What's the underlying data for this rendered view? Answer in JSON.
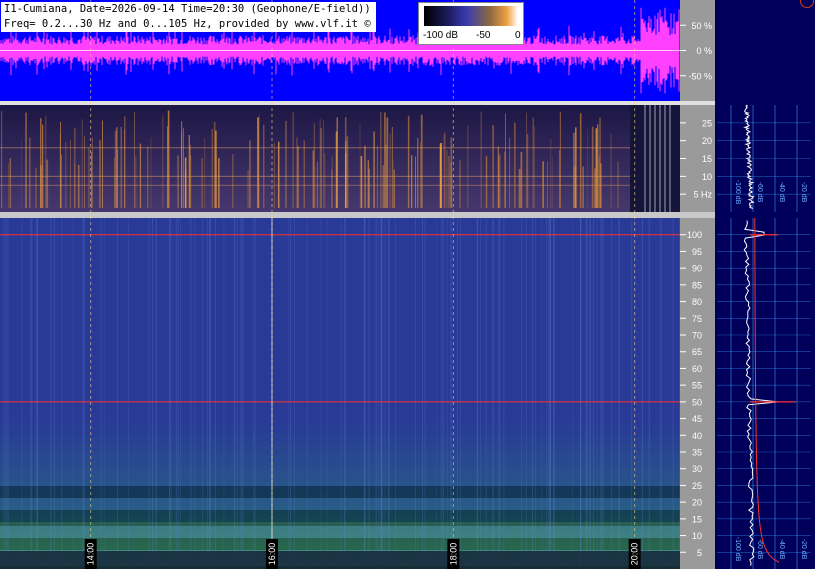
{
  "header": {
    "line1": "I1-Cumiana, Date=2026-09-14 Time=20:30 (Geophone/E-field))",
    "line2": "Freq= 0.2...30 Hz and 0...105 Hz, provided by www.vlf.it ©"
  },
  "colorbar": {
    "label_min": "-100 dB",
    "label_mid": "-50",
    "label_max": "0"
  },
  "colors": {
    "waveform_bg": "#0000ff",
    "waveform": "#ff40ff",
    "spectrum_line": "#ff3030",
    "profile": "#ffffff",
    "grid": "#3aa0ff",
    "right_bg": "#00005a"
  },
  "chart_data": [
    {
      "type": "line",
      "name": "waveform",
      "ylabel_ticks": [
        "50 %",
        "0 %",
        "-50 %"
      ],
      "ylim": [
        -100,
        100
      ],
      "xlim": [
        13.0,
        20.5
      ],
      "x_ticks": [
        "14:00",
        "16:00",
        "18:00",
        "20:00"
      ]
    },
    {
      "type": "heatmap",
      "name": "spectrogram-low",
      "ylabel_ticks": [
        "25",
        "20",
        "15",
        "10",
        "5 Hz"
      ],
      "ylim": [
        0,
        30
      ],
      "xlim": [
        13.0,
        20.5
      ]
    },
    {
      "type": "heatmap",
      "name": "spectrogram-high",
      "ylabel_ticks": [
        "100",
        "95",
        "90",
        "85",
        "80",
        "75",
        "70",
        "65",
        "60",
        "55",
        "50",
        "45",
        "40",
        "35",
        "30",
        "25",
        "20",
        "15",
        "10",
        "5"
      ],
      "ylim": [
        0,
        105
      ],
      "xlim": [
        13.0,
        20.5
      ],
      "x_ticks": [
        "14:00",
        "16:00",
        "18:00",
        "20:00"
      ],
      "lines_hz": [
        100,
        50
      ]
    },
    {
      "type": "line",
      "name": "profile-low",
      "x_ticks": [
        "-100 dB",
        "-60 dB",
        "-40 dB",
        "-20 dB"
      ],
      "ylim": [
        0,
        30
      ]
    },
    {
      "type": "line",
      "name": "profile-high",
      "x_ticks": [
        "-100 dB",
        "-60 dB",
        "-40 dB",
        "-20 dB"
      ],
      "ylim": [
        0,
        105
      ]
    }
  ]
}
